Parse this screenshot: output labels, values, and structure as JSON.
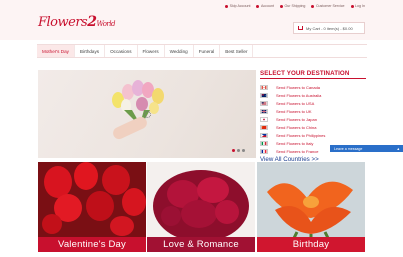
{
  "logo": {
    "part1": "Flowers",
    "part2": "2",
    "part3": "World"
  },
  "toplinks": [
    {
      "label": "Skip Account"
    },
    {
      "label": "Account"
    },
    {
      "label": "Our Shipping"
    },
    {
      "label": "Customer Service"
    },
    {
      "label": "Log In"
    }
  ],
  "cart": {
    "text": "My Cart - 0 item(s) - $0.00"
  },
  "nav": [
    "Mother's Day",
    "Birthdays",
    "Occasions",
    "Flowers",
    "Wedding",
    "Funeral",
    "Best Seller"
  ],
  "destinations": {
    "title": "SELECT YOUR DESTINATION",
    "items": [
      {
        "label": "Send Flowers to Canada",
        "flag": "canada"
      },
      {
        "label": "Send Flowers to Australia",
        "flag": "australia"
      },
      {
        "label": "Send Flowers to USA",
        "flag": "usa"
      },
      {
        "label": "Send Flowers to UK",
        "flag": "uk"
      },
      {
        "label": "Send Flowers to Japan",
        "flag": "japan"
      },
      {
        "label": "Send Flowers to China",
        "flag": "china"
      },
      {
        "label": "Send Flowers to Philippines",
        "flag": "philippines"
      },
      {
        "label": "Send Flowers to Italy",
        "flag": "italy"
      },
      {
        "label": "Send Flowers to France",
        "flag": "france"
      }
    ],
    "more": "View All Countries >>"
  },
  "chat": {
    "label": "Leave a message",
    "icon": "chevron-up-icon"
  },
  "tiles": [
    {
      "label": "Valentine's Day"
    },
    {
      "label": "Love & Romance"
    },
    {
      "label": "Birthday"
    }
  ],
  "colors": {
    "brand": "#c8102e",
    "link": "#1a3d8f",
    "chat": "#2a6fc9"
  }
}
